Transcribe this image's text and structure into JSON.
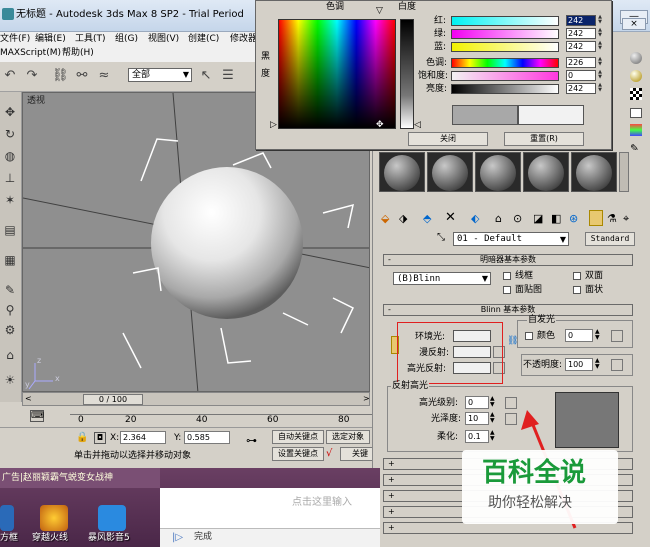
{
  "window": {
    "title": "无标题 - Autodesk 3ds Max 8 SP2  - Trial Period",
    "menu": [
      "文件(F)",
      "编辑(E)",
      "工具(T)",
      "组(G)",
      "视图(V)",
      "创建(C)",
      "修改器"
    ],
    "menu2": [
      "MAXScript(M)",
      "帮助(H)"
    ]
  },
  "toolbar": {
    "selection_filter": "全部"
  },
  "viewport": {
    "label": "透视",
    "axis_x": "x",
    "axis_y": "y",
    "axis_z": "z"
  },
  "timeline": {
    "frame": "0 / 100",
    "ruler_ticks": [
      "0",
      "20",
      "40",
      "60",
      "80"
    ]
  },
  "status": {
    "x_label": "X:",
    "x_value": "2.364",
    "y_label": "Y:",
    "y_value": "0.585",
    "auto_key": "自动关键点",
    "selected_object": "选定对象",
    "set_key": "设置关键点",
    "key_filter": "关键",
    "prompt": "单击并拖动以选择并移动对象"
  },
  "color_picker": {
    "hue_label": "色调",
    "whiteness_label": "白度",
    "blackness_label": "黑度",
    "rows": [
      {
        "label": "红:",
        "value": "242"
      },
      {
        "label": "绿:",
        "value": "242"
      },
      {
        "label": "蓝:",
        "value": "242"
      },
      {
        "label": "色调:",
        "value": "226"
      },
      {
        "label": "饱和度:",
        "value": "0"
      },
      {
        "label": "亮度:",
        "value": "242"
      }
    ],
    "close_button": "关闭",
    "reset_button": "重置(R)"
  },
  "material_editor": {
    "material_name": "01 - Default",
    "material_type": "Standard",
    "shader_rollout": "明暗器基本参数",
    "shader_type": "(B)Blinn",
    "wire": "线框",
    "two_sided": "双面",
    "face_map": "面贴图",
    "faceted": "面状",
    "blinn_rollout": "Blinn 基本参数",
    "self_illum": "自发光",
    "color_label": "颜色",
    "self_illum_value": "0",
    "ambient": "环境光:",
    "diffuse": "漫反射:",
    "specular": "高光反射:",
    "opacity_label": "不透明度:",
    "opacity_value": "100",
    "highlights_group": "反射高光",
    "spec_level": "高光级别:",
    "spec_level_value": "0",
    "glossiness": "光泽度:",
    "glossiness_value": "10",
    "soften": "柔化:",
    "soften_value": "0.1",
    "collapsed_rollouts": [
      "+",
      "+",
      "+",
      "+",
      "+"
    ]
  },
  "taskbar": {
    "ad_text": "广告|赵丽颖霸气蜕变女战神",
    "input_placeholder": "点击这里输入",
    "done": "完成",
    "icons": [
      "方框",
      "穿越火线",
      "暴风影音5"
    ]
  },
  "watermark": {
    "title": "百科全说",
    "subtitle": "助你轻松解决"
  },
  "colors": {
    "accent_red": "#e02020",
    "selected_blue": "#0a246a",
    "viewport_bg": "#8f8f8f"
  }
}
